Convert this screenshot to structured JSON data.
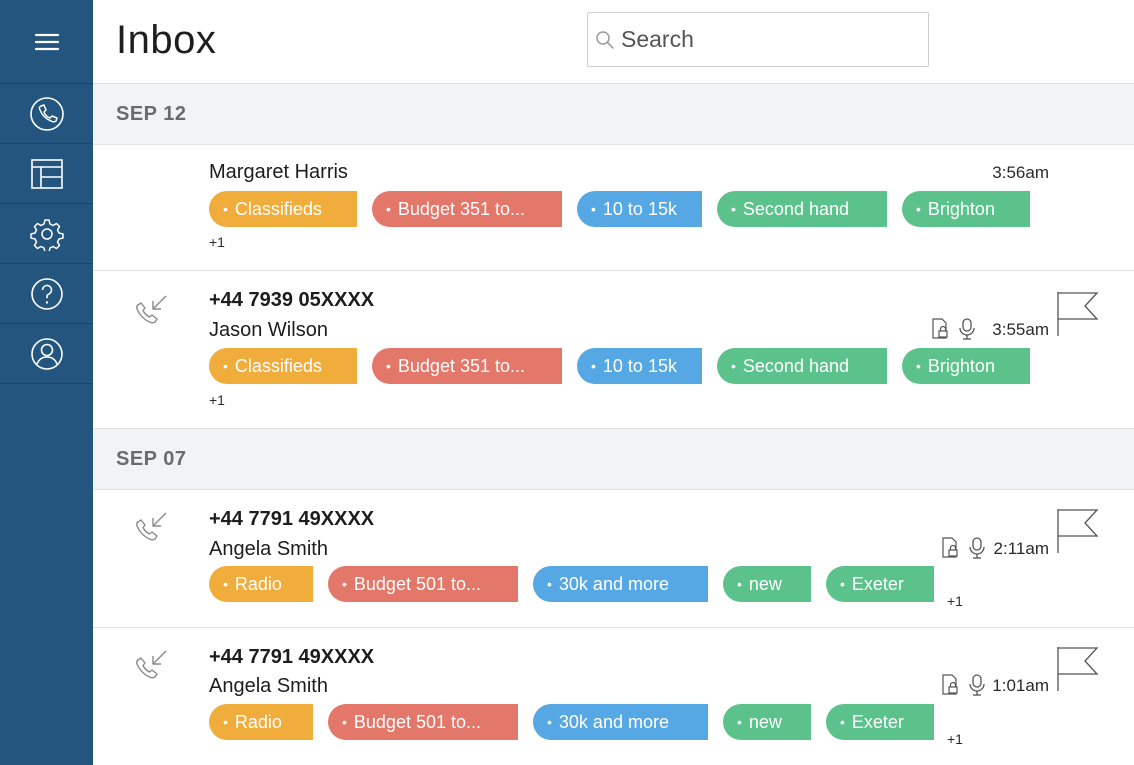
{
  "app": {
    "title": "Inbox"
  },
  "search": {
    "placeholder": "Search"
  },
  "sidebar": {
    "items": [
      {
        "name": "menu-icon"
      },
      {
        "name": "phone-icon"
      },
      {
        "name": "layout-icon"
      },
      {
        "name": "gear-icon"
      },
      {
        "name": "help-icon"
      },
      {
        "name": "user-icon"
      }
    ]
  },
  "colors": {
    "orange": "#f0ad3c",
    "red": "#e3776a",
    "blue": "#55a8e3",
    "green": "#5cc28c",
    "sidebar": "#23557e"
  },
  "groups": [
    {
      "date": "SEP 12",
      "items": [
        {
          "phone": "",
          "name": "Margaret Harris",
          "time": "3:56am",
          "tags": [
            "Classifieds",
            "Budget 351 to...",
            "10 to 15k",
            "Second hand",
            "Brighton"
          ],
          "more": "+1"
        },
        {
          "phone": "+44 7939 05XXXX",
          "name": "Jason Wilson",
          "time": "3:55am",
          "tags": [
            "Classifieds",
            "Budget 351 to...",
            "10 to 15k",
            "Second hand",
            "Brighton"
          ],
          "more": "+1"
        }
      ]
    },
    {
      "date": "SEP 07",
      "items": [
        {
          "phone": "+44 7791 49XXXX",
          "name": "Angela Smith",
          "time": "2:11am",
          "tags": [
            "Radio",
            "Budget 501 to...",
            "30k and more",
            "new",
            "Exeter"
          ],
          "more": "+1"
        },
        {
          "phone": "+44 7791 49XXXX",
          "name": "Angela Smith",
          "time": "1:01am",
          "tags": [
            "Radio",
            "Budget 501 to...",
            "30k and more",
            "new",
            "Exeter"
          ],
          "more": "+1"
        }
      ]
    }
  ]
}
